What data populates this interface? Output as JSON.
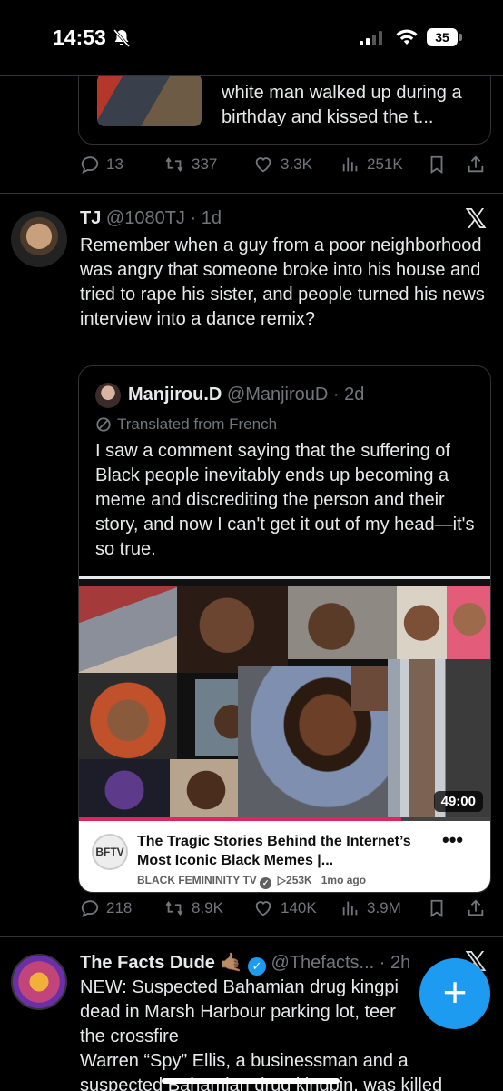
{
  "status_bar": {
    "time": "14:53",
    "battery": "35"
  },
  "prev_post": {
    "preview_text": "white man walked up during a birthday and kissed the t...",
    "actions": {
      "replies": "13",
      "reposts": "337",
      "likes": "3.3K",
      "views": "251K"
    }
  },
  "post_tj": {
    "name": "TJ",
    "handle": "@1080TJ",
    "time": "· 1d",
    "text": "Remember when a guy from a poor neighborhood was angry that someone broke into his house and tried to rape his sister, and people turned his news interview into a dance remix?",
    "quote": {
      "name": "Manjirou.D",
      "handle": "@ManjirouD",
      "time": "· 2d",
      "translated_label": "Translated from French",
      "text": "I saw a comment saying that the suffering of Black people inevitably ends up becoming a meme and discrediting the person and their story, and now I can't get it out of my head—it's so true.",
      "video": {
        "duration": "49:00",
        "progress": 0.78,
        "title": "The Tragic Stories Behind the Internet’s Most Iconic Black Memes |...",
        "channel": "BLACK FEMININITY TV",
        "views": "253K",
        "age": "1mo ago"
      }
    },
    "actions": {
      "replies": "218",
      "reposts": "8.9K",
      "likes": "140K",
      "views": "3.9M"
    }
  },
  "post_facts": {
    "name": "The Facts Dude",
    "emoji": "🤙🏽",
    "handle": "@Thefacts...",
    "time": "· 2h",
    "text_lines": [
      "NEW: Suspected Bahamian drug kingpi",
      "dead in Marsh Harbour parking lot, teer",
      "the crossfire",
      "Warren “Spy” Ellis, a businessman and a",
      "suspected Bahamian drug kingpin, was killed"
    ]
  },
  "colors": {
    "background": "#000000",
    "text": "#e7e9ea",
    "muted": "#71767b",
    "accent": "#1d9bf0",
    "verified": "#1d9bf0"
  }
}
